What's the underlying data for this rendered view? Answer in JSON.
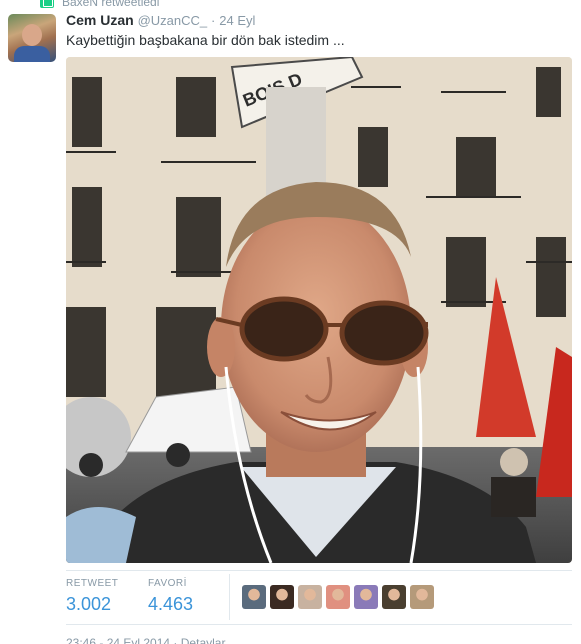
{
  "retweet": {
    "text": "BaxeN retweetledi",
    "icon": "retweet-icon"
  },
  "author": {
    "name": "Cem Uzan",
    "handle": "@UzanCC_",
    "separator": "·",
    "time": "24 Eyl"
  },
  "tweet": {
    "text": "Kaybettiğin başbakana bir dön bak istedim ..."
  },
  "photo": {
    "sign_text": "BOIS D"
  },
  "stats": {
    "retweet_label": "RETWEET",
    "retweet_count": "3.002",
    "favorite_label": "FAVORİ",
    "favorite_count": "4.463"
  },
  "favoriters": [
    {
      "color": "#5a6b7d"
    },
    {
      "color": "#3b2a22"
    },
    {
      "color": "#c8b2a0"
    },
    {
      "color": "#e09080"
    },
    {
      "color": "#8a7ab8"
    },
    {
      "color": "#4a3f30"
    },
    {
      "color": "#b59a7a"
    }
  ],
  "footer": {
    "timestamp": "23:46 - 24 Eyl 2014",
    "separator": "·",
    "details_link": "Detaylar"
  },
  "colors": {
    "accent": "#3b94d9",
    "muted": "#8899a6",
    "retweet_green": "#19cf86"
  }
}
